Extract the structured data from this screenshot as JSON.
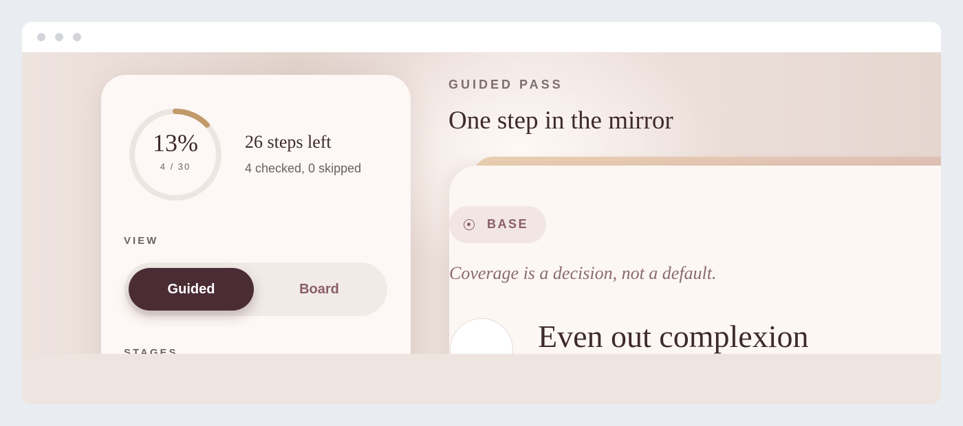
{
  "progress": {
    "percent_label": "13%",
    "fraction": 0.13,
    "count_label": "4 / 30",
    "steps_left": "26 steps left",
    "summary": "4 checked, 0 skipped"
  },
  "view": {
    "label": "VIEW",
    "options": [
      {
        "label": "Guided",
        "active": true
      },
      {
        "label": "Board",
        "active": false
      }
    ]
  },
  "stages": {
    "label": "STAGES"
  },
  "main": {
    "eyebrow": "GUIDED PASS",
    "title": "One step in the mirror",
    "step": {
      "badge_icon": "target-icon",
      "badge": "BASE",
      "tagline": "Coverage is a decision, not a default.",
      "title": "Even out complexion"
    }
  },
  "colors": {
    "accent": "#4a2c34",
    "ring_progress": "#c19a6b",
    "ring_track": "#ede5e1",
    "badge_text": "#8a5d6a"
  }
}
